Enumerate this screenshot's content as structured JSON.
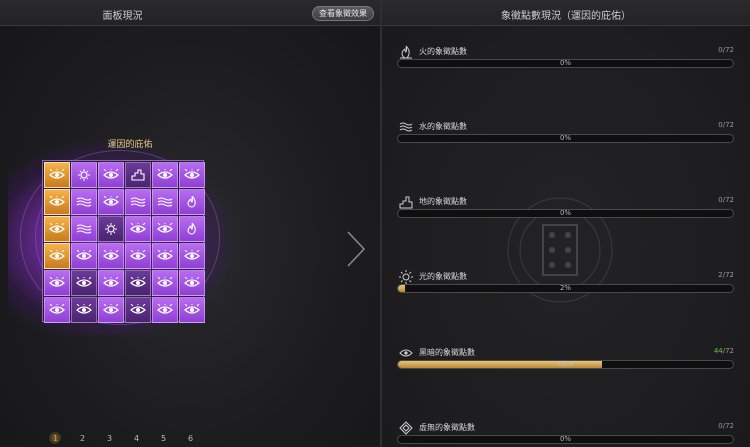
{
  "left_panel": {
    "title": "面板現況",
    "view_effect_button": "查看象徵效果",
    "board_title": "運因的庇佑",
    "grid": [
      [
        {
          "c": "gold",
          "i": "eye"
        },
        {
          "c": "pl",
          "i": "sun"
        },
        {
          "c": "pl",
          "i": "eye"
        },
        {
          "c": "pd",
          "i": "earth"
        },
        {
          "c": "pl",
          "i": "eye"
        },
        {
          "c": "pl",
          "i": "eye"
        }
      ],
      [
        {
          "c": "gold",
          "i": "eye"
        },
        {
          "c": "pl",
          "i": "water"
        },
        {
          "c": "pl",
          "i": "eye"
        },
        {
          "c": "pl",
          "i": "water"
        },
        {
          "c": "pl",
          "i": "water"
        },
        {
          "c": "pl",
          "i": "fire"
        }
      ],
      [
        {
          "c": "gold",
          "i": "eye"
        },
        {
          "c": "pl",
          "i": "water"
        },
        {
          "c": "pd",
          "i": "sun"
        },
        {
          "c": "pl",
          "i": "eye"
        },
        {
          "c": "pl",
          "i": "eye"
        },
        {
          "c": "pl",
          "i": "fire"
        }
      ],
      [
        {
          "c": "gold",
          "i": "eye"
        },
        {
          "c": "pl",
          "i": "eye"
        },
        {
          "c": "pl",
          "i": "eye"
        },
        {
          "c": "pl",
          "i": "eye"
        },
        {
          "c": "pl",
          "i": "eye"
        },
        {
          "c": "pl",
          "i": "eye"
        }
      ],
      [
        {
          "c": "pl",
          "i": "eye"
        },
        {
          "c": "pd",
          "i": "eye"
        },
        {
          "c": "pl",
          "i": "eye"
        },
        {
          "c": "pd",
          "i": "eye"
        },
        {
          "c": "pl",
          "i": "eye"
        },
        {
          "c": "pl",
          "i": "eye"
        }
      ],
      [
        {
          "c": "pl",
          "i": "eye"
        },
        {
          "c": "pd",
          "i": "eye"
        },
        {
          "c": "pl",
          "i": "eye"
        },
        {
          "c": "pd",
          "i": "eye"
        },
        {
          "c": "pl",
          "i": "eye"
        },
        {
          "c": "pl",
          "i": "eye"
        }
      ]
    ],
    "pages": [
      "1",
      "2",
      "3",
      "4",
      "5",
      "6"
    ],
    "active_page": 0
  },
  "right_panel": {
    "title": "象徵點數現況（運因的庇佑）",
    "stats": [
      {
        "name": "火的象徵點數",
        "current": "0",
        "max": "/72",
        "percent": "0%",
        "fill": 0,
        "icon": "fire-icon",
        "highlight": false
      },
      {
        "name": "水的象徵點數",
        "current": "0",
        "max": "/72",
        "percent": "0%",
        "fill": 0,
        "icon": "water-icon",
        "highlight": false
      },
      {
        "name": "地的象徵點數",
        "current": "0",
        "max": "/72",
        "percent": "0%",
        "fill": 0,
        "icon": "earth-icon",
        "highlight": false
      },
      {
        "name": "光的象徵點數",
        "current": "2",
        "max": "/72",
        "percent": "2%",
        "fill": 0.02,
        "icon": "sun-icon",
        "highlight": false
      },
      {
        "name": "黑暗的象徵點數",
        "current": "44",
        "max": "/72",
        "percent": "61%",
        "fill": 0.61,
        "icon": "eye-icon",
        "highlight": true
      },
      {
        "name": "虛無的象徵點數",
        "current": "0",
        "max": "/72",
        "percent": "0%",
        "fill": 0,
        "icon": "void-icon",
        "highlight": false
      }
    ]
  },
  "colors": {
    "gold_cell": "#f4b34a",
    "purple_cell": "#b86cf0",
    "dark_purple_cell": "#6c3a9a",
    "bar_fill": "#e8c57a",
    "highlight_count": "#66c247"
  }
}
